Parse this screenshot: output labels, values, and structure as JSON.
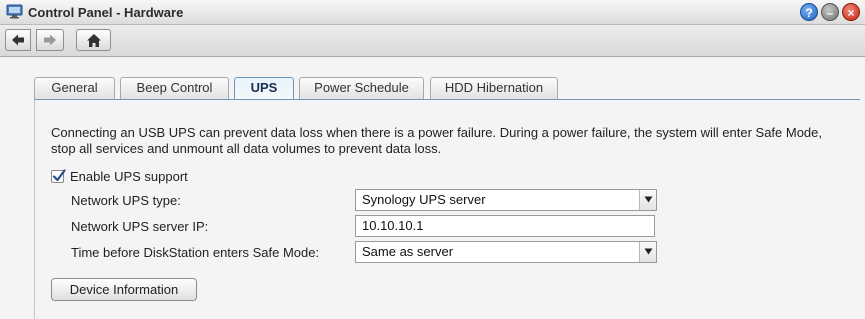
{
  "window": {
    "title": "Control Panel - Hardware"
  },
  "toolbar": {
    "back_icon": "arrow-left-icon",
    "forward_icon": "arrow-right-icon",
    "home_icon": "home-icon"
  },
  "window_controls": {
    "help": "?",
    "minimize": "–",
    "close": "×"
  },
  "tabs": [
    {
      "label": "General",
      "active": false
    },
    {
      "label": "Beep Control",
      "active": false
    },
    {
      "label": "UPS",
      "active": true
    },
    {
      "label": "Power Schedule",
      "active": false
    },
    {
      "label": "HDD Hibernation",
      "active": false
    }
  ],
  "ups": {
    "description": "Connecting an USB UPS can prevent data loss when there is a power failure. During a power failure, the system will enter Safe Mode, stop all services and unmount all data volumes to prevent data loss.",
    "enable_label": "Enable UPS support",
    "enable_checked": true,
    "network_type_label": "Network UPS type:",
    "network_type_value": "Synology UPS server",
    "server_ip_label": "Network UPS server IP:",
    "server_ip_value": "10.10.10.1",
    "safe_mode_label": "Time before DiskStation enters Safe Mode:",
    "safe_mode_value": "Same as server",
    "device_info_button": "Device Information"
  },
  "colors": {
    "active_tab_border": "#6a97c0",
    "close_button": "#c3210e",
    "help_button": "#1a5fbf"
  }
}
